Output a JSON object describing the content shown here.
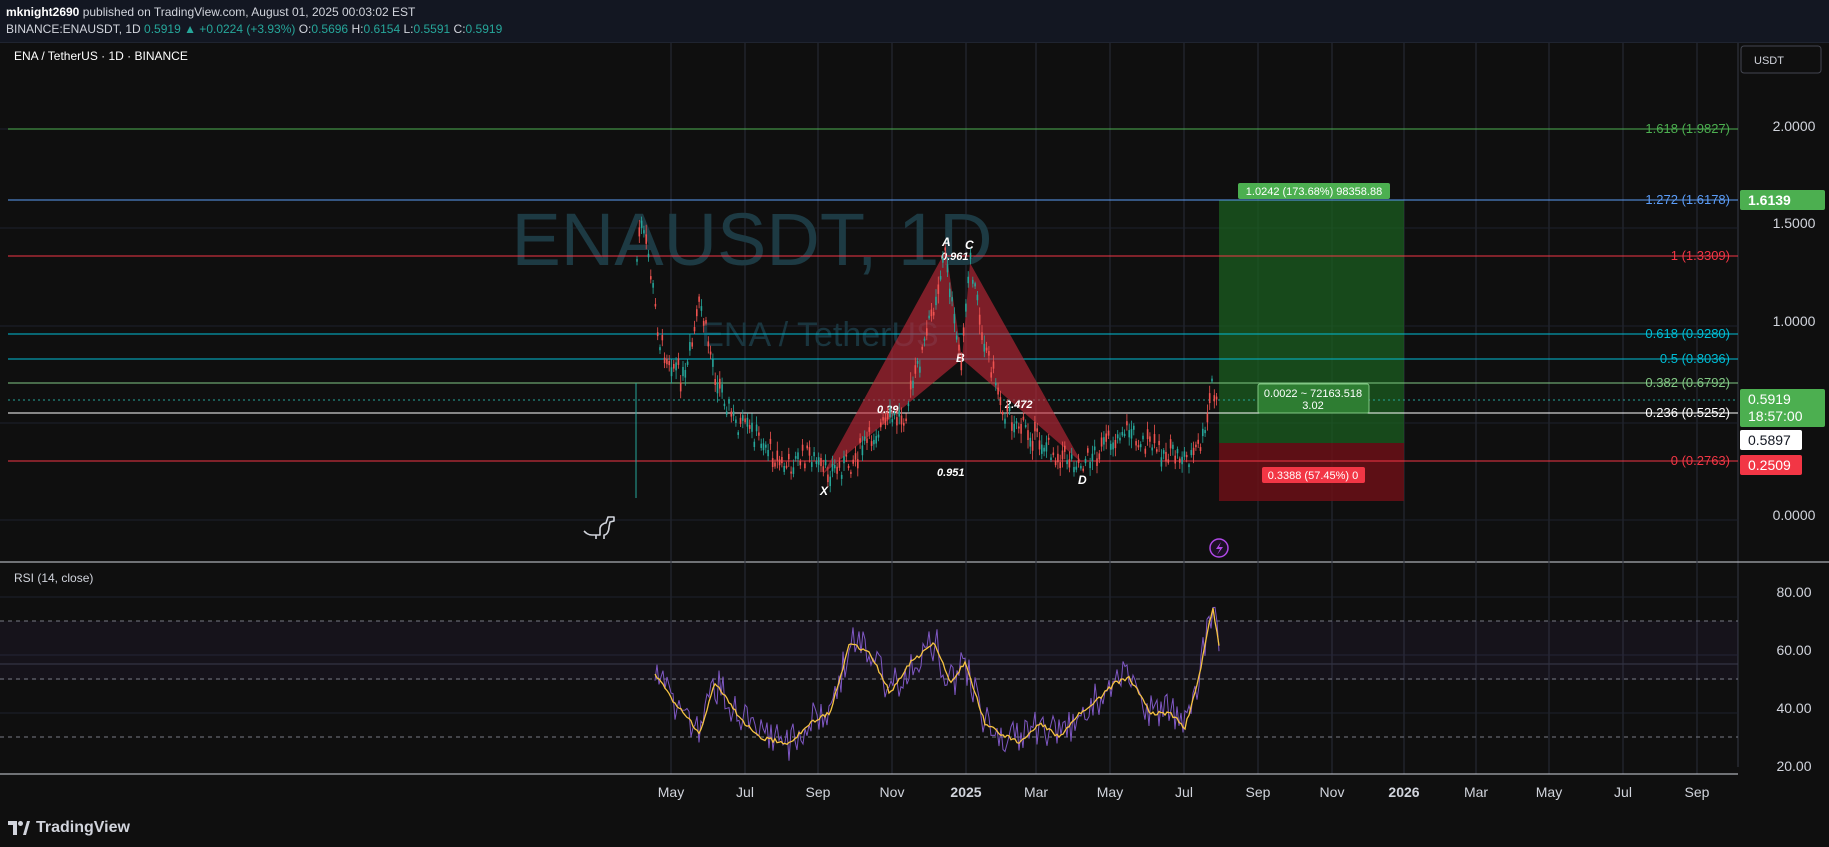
{
  "header": {
    "publisher": "mknight2690",
    "published_text": "published on TradingView.com, August 01, 2025 00:03:02 EST",
    "symbol_line": "BINANCE:ENAUSDT, 1D",
    "last": "0.5919",
    "change": "▲ +0.0224 (+3.93%)",
    "o_label": "O:",
    "o": "0.5696",
    "h_label": "H:",
    "h": "0.6154",
    "l_label": "L:",
    "l": "0.5591",
    "c_label": "C:",
    "c": "0.5919"
  },
  "chart_title": "ENA / TetherUS · 1D · BINANCE",
  "watermark": {
    "big": "ENAUSDT, 1D",
    "small": "ENA / TetherUS"
  },
  "currency_button": "USDT",
  "price_axis": [
    "2.0000",
    "1.5000",
    "1.0000",
    "0.0000"
  ],
  "fib_levels": [
    {
      "label": "1.618 (1.9827)",
      "color": "#4caf50"
    },
    {
      "label": "1.272 (1.6178)",
      "color": "#5b9cf6"
    },
    {
      "label": "1 (1.3309)",
      "color": "#f23645"
    },
    {
      "label": "0.618 (0.9280)",
      "color": "#00bcd4"
    },
    {
      "label": "0.5 (0.8036)",
      "color": "#00bcd4"
    },
    {
      "label": "0.382 (0.6792)",
      "color": "#81c784"
    },
    {
      "label": "0.236 (0.5252)",
      "color": "#ffffff"
    },
    {
      "label": "0 (0.2763)",
      "color": "#f23645"
    }
  ],
  "price_badges": {
    "target": "1.6139",
    "last": "0.5919",
    "countdown": "18:57:00",
    "ref": "0.5897",
    "stop": "0.2509"
  },
  "position": {
    "target_label": "1.0242 (173.68%) 98358.88",
    "entry_label": "0.0022 ~ 72163.518",
    "ratio": "3.02",
    "stop_label": "0.3388 (57.45%) 0"
  },
  "pattern": {
    "points": [
      "X",
      "A",
      "B",
      "C",
      "D"
    ],
    "ratios": [
      "0.961",
      "0.951",
      "0.39",
      "2.472"
    ]
  },
  "rsi": {
    "title": "RSI (14, close)",
    "axis": [
      "80.00",
      "60.00",
      "40.00",
      "20.00"
    ]
  },
  "time_axis": [
    "May",
    "Jul",
    "Sep",
    "Nov",
    "2025",
    "Mar",
    "May",
    "Jul",
    "Sep",
    "Nov",
    "2026",
    "Mar",
    "May",
    "Jul",
    "Sep"
  ],
  "footer": {
    "brand": "TradingView"
  }
}
